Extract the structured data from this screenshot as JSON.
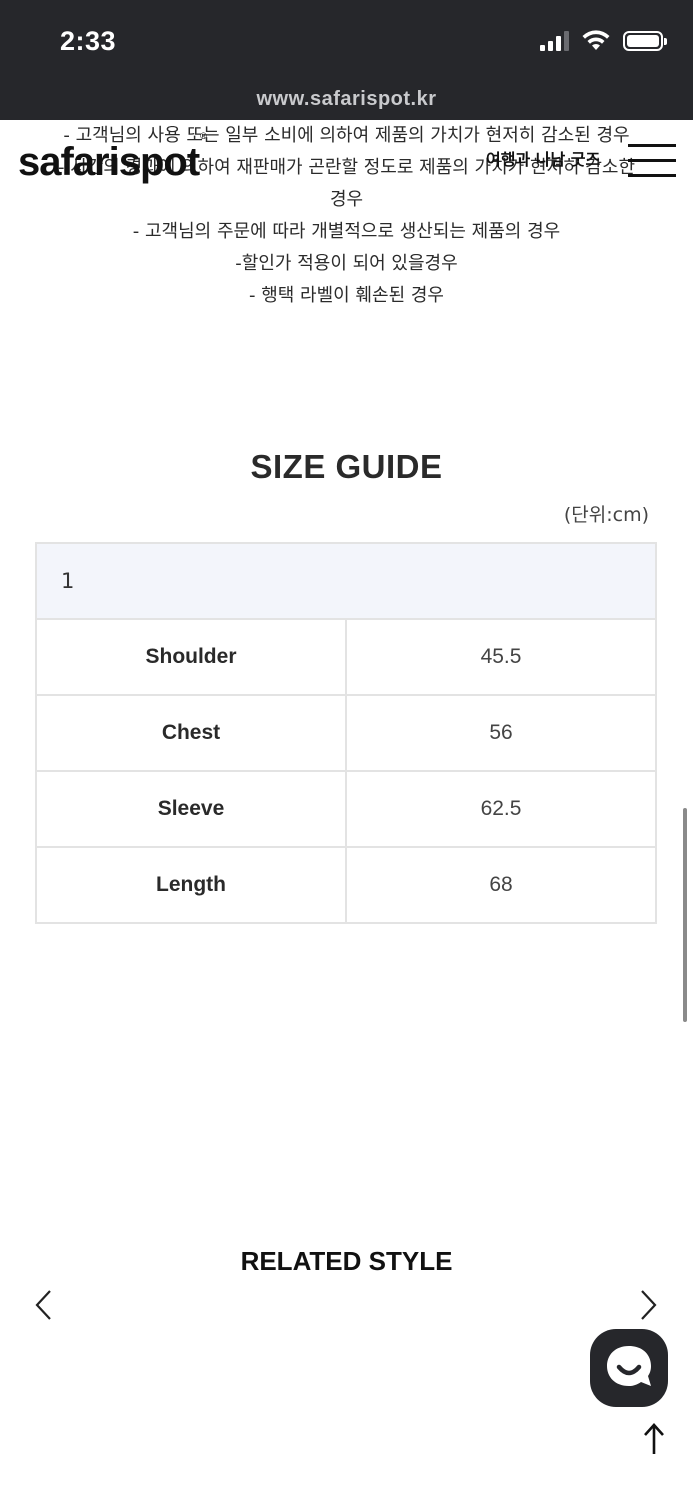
{
  "status_bar": {
    "time": "2:33",
    "signal_icon": "cellular-signal-icon",
    "wifi_icon": "wifi-icon",
    "battery_icon": "battery-icon"
  },
  "browser": {
    "url": "www.safarispot.kr"
  },
  "header": {
    "logo": "safarispot",
    "logo_mark": "®",
    "link": "여행과 나남 굿즈",
    "menu_icon": "hamburger-menu-icon"
  },
  "notice_lines": [
    "- 고객님의 사용 또는 일부 소비에 의하여 제품의 가치가 현저히 감소된 경우",
    "- 시간의 경과에 의하여 재판매가 곤란할 정도로 제품의 가치가 현저히 감소한",
    "경우",
    "- 고객님의 주문에 따라 개별적으로 생산되는 제품의 경우",
    "-할인가 적용이 되어 있을경우",
    "- 행택 라벨이 훼손된 경우"
  ],
  "size_guide": {
    "title": "SIZE GUIDE",
    "unit": "(단위:cm)",
    "size_label": "1",
    "rows": [
      {
        "label": "Shoulder",
        "value": "45.5"
      },
      {
        "label": "Chest",
        "value": "56"
      },
      {
        "label": "Sleeve",
        "value": "62.5"
      },
      {
        "label": "Length",
        "value": "68"
      }
    ]
  },
  "related": {
    "title": "RELATED STYLE",
    "prev_icon": "chevron-left-icon",
    "next_icon": "chevron-right-icon"
  },
  "floating": {
    "chat_icon": "chat-bubble-icon",
    "top_icon": "arrow-up-icon"
  },
  "colors": {
    "status_bar_bg": "#26272b",
    "table_header_bg": "#f3f5fb",
    "table_border": "#e3e3e3"
  }
}
